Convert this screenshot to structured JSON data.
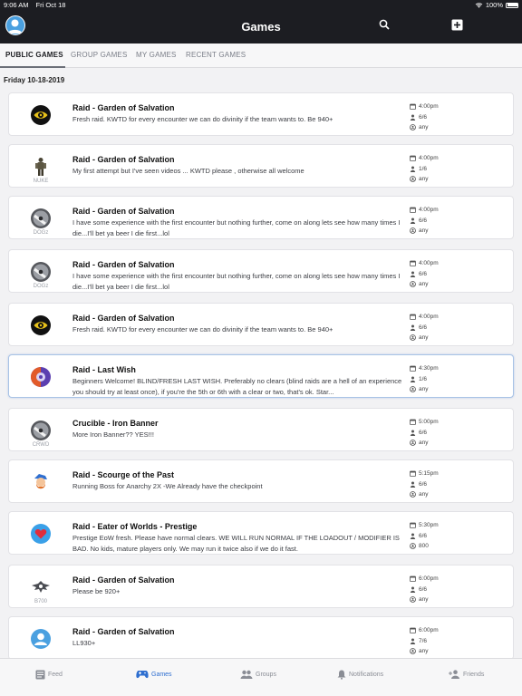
{
  "status": {
    "time": "9:06 AM",
    "date": "Fri Oct 18",
    "battery": "100%"
  },
  "nav": {
    "title": "Games"
  },
  "tabs": [
    "PUBLIC GAMES",
    "GROUP GAMES",
    "MY GAMES",
    "RECENT GAMES"
  ],
  "date_header": "Friday 10-18-2019",
  "games": [
    {
      "title": "Raid - Garden of Salvation",
      "desc": "Fresh raid. KWTD for every encounter we can do divinity if the team wants to. Be 940+",
      "time": "4:00pm",
      "players": "6/6",
      "power": "any",
      "icon": "eye-emblem-icon",
      "icon_label": ""
    },
    {
      "title": "Raid - Garden of Salvation",
      "desc": "My first attempt but I've seen videos ... KWTD please , otherwise all welcome",
      "time": "4:00pm",
      "players": "1/6",
      "power": "any",
      "icon": "soldier-figure-icon",
      "icon_label": "NUKE"
    },
    {
      "title": "Raid - Garden of Salvation",
      "desc": "I have some experience with the first encounter but nothing further, come on along lets see how many times I die...I'll bet ya beer I die first...lol",
      "time": "4:00pm",
      "players": "6/6",
      "power": "any",
      "icon": "ghost-shell-icon",
      "icon_label": "DOGz"
    },
    {
      "title": "Raid - Garden of Salvation",
      "desc": "I have some experience with the first encounter but nothing further, come on along lets see how many times I die...I'll bet ya beer I die first...lol",
      "time": "4:00pm",
      "players": "6/6",
      "power": "any",
      "icon": "ghost-shell-icon",
      "icon_label": "DOGz"
    },
    {
      "title": "Raid - Garden of Salvation",
      "desc": "Fresh raid. KWTD for every encounter we can do divinity if the team wants to. Be 940+",
      "time": "4:00pm",
      "players": "6/6",
      "power": "any",
      "icon": "eye-emblem-icon",
      "icon_label": ""
    },
    {
      "title": "Raid - Last Wish",
      "desc": "Beginners Welcome! BLIND/FRESH LAST WISH. Preferably no clears (blind raids are a hell of an experience you should try at least once), if you're the 5th or 6th with a clear or two, that's ok. Star...",
      "time": "4:30pm",
      "players": "1/6",
      "power": "any",
      "icon": "purple-orb-icon",
      "icon_label": "",
      "selected": true
    },
    {
      "title": "Crucible - Iron Banner",
      "desc": "More Iron Banner?? YES!!!",
      "time": "5:00pm",
      "players": "6/6",
      "power": "any",
      "icon": "ghost-shell-icon",
      "icon_label": "CRWD"
    },
    {
      "title": "Raid - Scourge of the Past",
      "desc": "Running Boss for Anarchy 2X    -We Already have the checkpoint",
      "time": "5:15pm",
      "players": "6/6",
      "power": "any",
      "icon": "cartoon-avatar-icon",
      "icon_label": ""
    },
    {
      "title": "Raid - Eater of Worlds - Prestige",
      "desc": "Prestige EoW fresh. Please have normal clears. WE WILL RUN NORMAL IF THE LOADOUT / MODIFIER IS BAD. No kids, mature players only. We may run it twice also if we do it fast.",
      "time": "5:30pm",
      "players": "6/6",
      "power": "800",
      "icon": "heart-badge-icon",
      "icon_label": ""
    },
    {
      "title": "Raid - Garden of Salvation",
      "desc": "Please be 920+",
      "time": "6:00pm",
      "players": "6/6",
      "power": "any",
      "icon": "winged-emblem-icon",
      "icon_label": "B700"
    },
    {
      "title": "Raid - Garden of Salvation",
      "desc": "LL930+",
      "time": "6:00pm",
      "players": "7/6",
      "power": "any",
      "icon": "default-user-icon",
      "icon_label": ""
    }
  ],
  "tabbar": {
    "feed": "Feed",
    "games": "Games",
    "groups": "Groups",
    "notifications": "Notifications",
    "friends": "Friends"
  },
  "colors": {
    "header": "#1c1d22",
    "accent": "#2f6fd0",
    "background": "#f2f2f4"
  }
}
